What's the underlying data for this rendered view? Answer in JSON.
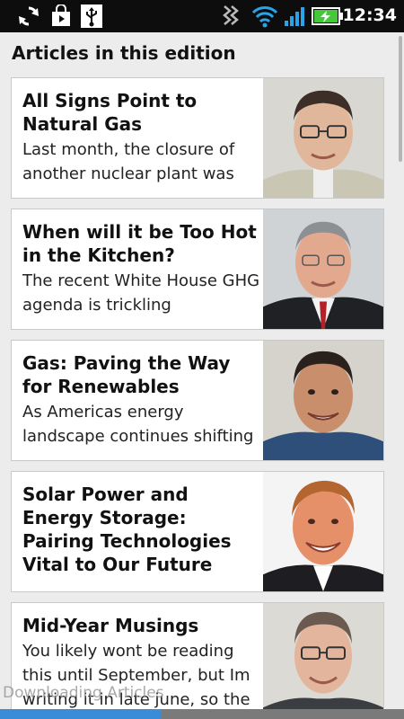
{
  "status_bar": {
    "time": "12:34",
    "icons": [
      "sync-icon",
      "shopping-bag-icon",
      "usb-icon",
      "vibrate-icon",
      "wifi-icon",
      "signal-icon",
      "battery-charging-icon"
    ]
  },
  "heading": "Articles in this edition",
  "articles": [
    {
      "title": "All Signs Point to Natural Gas",
      "snippet": "Last month, the closure of another nuclear plant was"
    },
    {
      "title": "When will it be Too Hot in the Kitchen?",
      "snippet": "The recent White House GHG agenda is trickling"
    },
    {
      "title": "Gas: Paving the Way for Renewables",
      "snippet": "As Americas energy landscape continues shifting"
    },
    {
      "title": "Solar Power and Energy Storage: Pairing Technologies Vital to Our Future",
      "snippet": ""
    },
    {
      "title": "Mid-Year Musings",
      "snippet": "You likely wont be reading this until September, but Im writing it in late june, so the"
    }
  ],
  "download": {
    "label": "Downloading Articles",
    "progress": 0.4
  },
  "colors": {
    "status_bar": "#0d0d0d",
    "background": "#ececec",
    "progress_fill": "#3a8bd8",
    "progress_track": "#7a7a7a"
  }
}
